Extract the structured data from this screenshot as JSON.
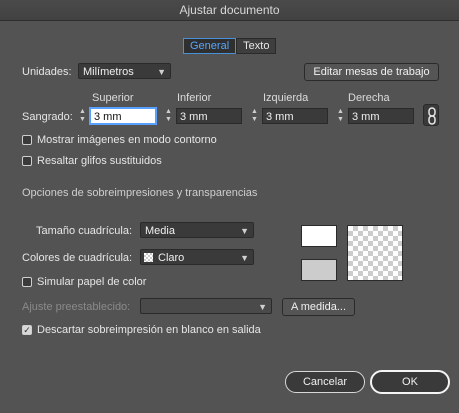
{
  "window": {
    "title": "Ajustar documento"
  },
  "tabs": [
    {
      "label": "General",
      "active": true
    },
    {
      "label": "Texto",
      "active": false
    }
  ],
  "units": {
    "label": "Unidades:",
    "value": "Milímetros"
  },
  "edit_artboards_button": "Editar mesas de trabajo",
  "bleed": {
    "label": "Sangrado:",
    "headers": {
      "top": "Superior",
      "bottom": "Inferior",
      "left": "Izquierda",
      "right": "Derecha"
    },
    "values": {
      "top": "3 mm",
      "bottom": "3 mm",
      "left": "3 mm",
      "right": "3 mm"
    },
    "link_icon": "link-icon"
  },
  "options": {
    "show_images_outline": {
      "label": "Mostrar imágenes en modo contorno",
      "checked": false
    },
    "highlight_glyphs": {
      "label": "Resaltar glifos sustituidos",
      "checked": false
    }
  },
  "overprint": {
    "section_title": "Opciones de sobreimpresiones y transparencias",
    "grid_size": {
      "label": "Tamaño cuadrícula:",
      "value": "Media"
    },
    "grid_colors": {
      "label": "Colores de cuadrícula:",
      "value": "Claro"
    },
    "simulate_paper": {
      "label": "Simular papel de color",
      "checked": false
    },
    "preset": {
      "label": "Ajuste preestablecido:",
      "value": ""
    },
    "custom_button": "A medida...",
    "discard_white": {
      "label": "Descartar sobreimpresión en blanco en salida",
      "checked": true
    }
  },
  "footer": {
    "cancel": "Cancelar",
    "ok": "OK"
  },
  "colors": {
    "accent": "#57a6ff",
    "background": "#535353"
  }
}
